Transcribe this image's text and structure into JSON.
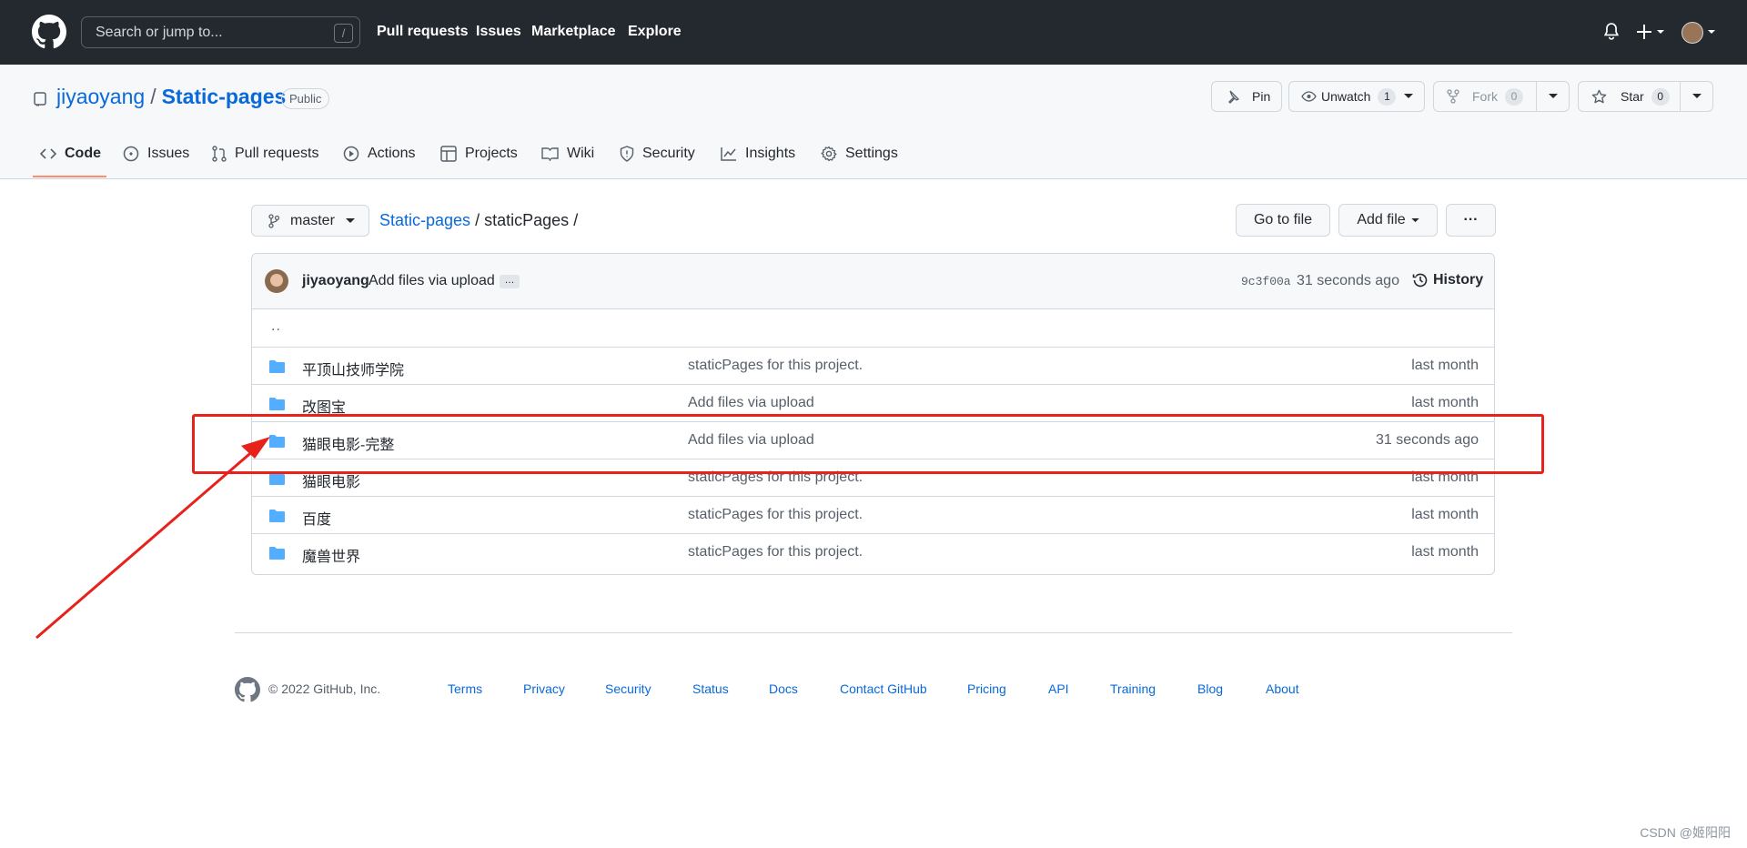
{
  "header": {
    "search_placeholder": "Search or jump to...",
    "search_shortcut": "/",
    "nav": [
      "Pull requests",
      "Issues",
      "Marketplace",
      "Explore"
    ]
  },
  "repo": {
    "owner": "jiyaoyang",
    "separator": "/",
    "name": "Static-pages",
    "visibility": "Public",
    "actions": {
      "pin": "Pin",
      "unwatch": "Unwatch",
      "unwatch_count": "1",
      "fork": "Fork",
      "fork_count": "0",
      "star": "Star",
      "star_count": "0"
    },
    "tabs": [
      "Code",
      "Issues",
      "Pull requests",
      "Actions",
      "Projects",
      "Wiki",
      "Security",
      "Insights",
      "Settings"
    ]
  },
  "toolbar": {
    "branch": "master",
    "breadcrumb_root": "Static-pages",
    "breadcrumb_sep": "/",
    "breadcrumb_dir": "staticPages",
    "go_to_file": "Go to file",
    "add_file": "Add file",
    "more": "···"
  },
  "commit": {
    "author": "jiyaoyang",
    "message": "Add files via upload",
    "ellipsis": "…",
    "sha": "9c3f00a",
    "time": "31 seconds ago",
    "history": "History"
  },
  "files": {
    "parent": "..",
    "rows": [
      {
        "name": "平顶山技师学院",
        "message": "staticPages for this project.",
        "age": "last month"
      },
      {
        "name": "改图宝",
        "message": "Add files via upload",
        "age": "last month"
      },
      {
        "name": "猫眼电影-完整",
        "message": "Add files via upload",
        "age": "31 seconds ago"
      },
      {
        "name": "猫眼电影",
        "message": "staticPages for this project.",
        "age": "last month"
      },
      {
        "name": "百度",
        "message": "staticPages for this project.",
        "age": "last month"
      },
      {
        "name": "魔兽世界",
        "message": "staticPages for this project.",
        "age": "last month"
      }
    ]
  },
  "footer": {
    "copyright": "© 2022 GitHub, Inc.",
    "links": [
      "Terms",
      "Privacy",
      "Security",
      "Status",
      "Docs",
      "Contact GitHub",
      "Pricing",
      "API",
      "Training",
      "Blog",
      "About"
    ]
  },
  "watermark": "CSDN @姬阳阳",
  "colors": {
    "header_bg": "#24292f",
    "link": "#0969da",
    "folder": "#54aeff",
    "annotation": "#e8211b",
    "tab_underline": "#fd8c73"
  }
}
